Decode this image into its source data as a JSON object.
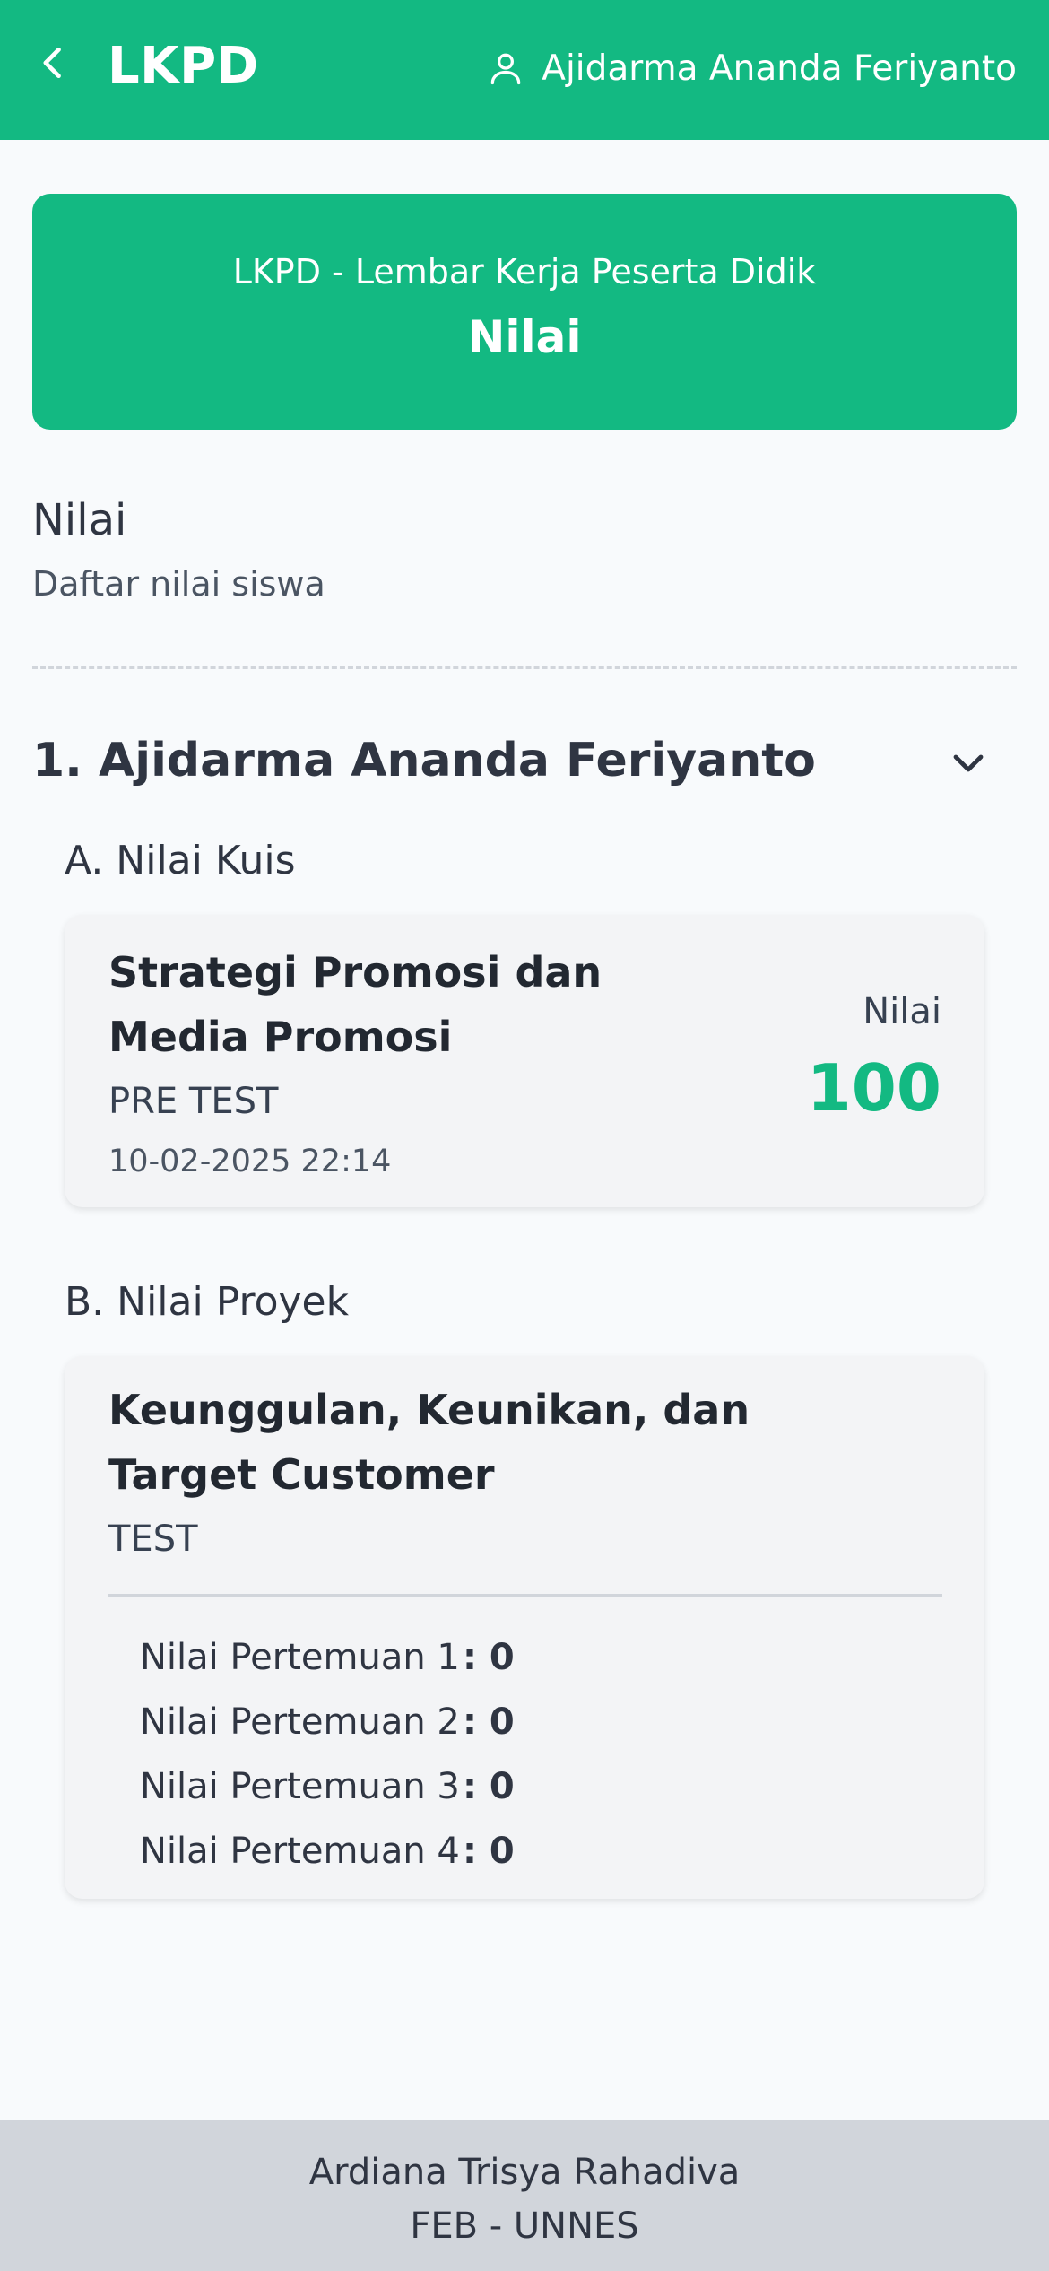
{
  "header": {
    "title": "LKPD",
    "user_name": "Ajidarma Ananda Feriyanto",
    "back_icon": "chevron-left-icon",
    "user_icon": "user-icon"
  },
  "hero": {
    "subtitle": "LKPD - Lembar Kerja Peserta Didik",
    "title": "Nilai"
  },
  "section": {
    "title": "Nilai",
    "subtitle": "Daftar nilai siswa"
  },
  "student": {
    "name": "1. Ajidarma Ananda Feriyanto",
    "expand_icon": "chevron-down-icon",
    "quiz": {
      "heading": "A. Nilai Kuis",
      "title": "Strategi Promosi dan Media Promosi",
      "type": "PRE TEST",
      "date": "10-02-2025 22:14",
      "score_label": "Nilai",
      "score": "100"
    },
    "project": {
      "heading": "B. Nilai Proyek",
      "title": "Keunggulan, Keunikan, dan Target Customer",
      "type": "TEST",
      "meetings": [
        {
          "label": "Nilai Pertemuan 1",
          "value": ": 0"
        },
        {
          "label": "Nilai Pertemuan 2",
          "value": ": 0"
        },
        {
          "label": "Nilai Pertemuan 3",
          "value": ": 0"
        },
        {
          "label": "Nilai Pertemuan 4",
          "value": ": 0"
        }
      ]
    }
  },
  "footer": {
    "name": "Ardiana Trisya Rahadiva",
    "org": "FEB - UNNES"
  },
  "colors": {
    "accent": "#13b982",
    "background": "#f8fafc",
    "card": "#f3f4f6",
    "footer": "#d1d5db"
  }
}
